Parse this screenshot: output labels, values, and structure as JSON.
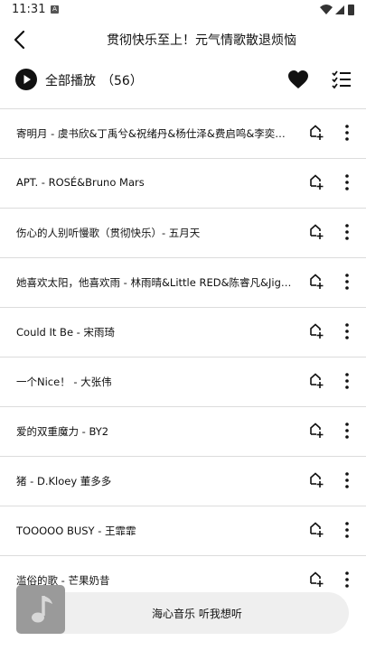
{
  "status": {
    "time": "11:31",
    "indicator": "A"
  },
  "header": {
    "title": "贯彻快乐至上！元气情歌散退烦恼"
  },
  "play_all": {
    "label": "全部播放",
    "count": "（56）"
  },
  "songs": [
    "寄明月 - 虞书欣&丁禹兮&祝绪丹&杨仕泽&费启鸣&李奕臻…",
    "APT. - ROSÉ&Bruno Mars",
    "伤心的人别听慢歌（贯彻快乐）- 五月天",
    "她喜欢太阳，他喜欢雨 - 林雨晴&Little RED&陈睿凡&Jiggl…",
    "Could It Be - 宋雨琦",
    "一个Nice！ - 大张伟",
    "爱的双重魔力 - BY2",
    "猪 - D.Kloey 董多多",
    "TOOOOO BUSY - 王霏霏",
    "滥俗的歌 - 芒果奶昔"
  ],
  "mini_player": {
    "title": "海心音乐 听我想听"
  },
  "icons": {
    "back": "back-arrow-icon",
    "play": "play-icon",
    "heart": "heart-icon",
    "list": "checklist-icon",
    "add": "add-to-playlist-icon",
    "more": "more-vertical-icon",
    "music": "music-note-icon"
  },
  "colors": {
    "accent": "#111111",
    "divider": "#dcdcdc",
    "player_bg": "#efefef"
  }
}
